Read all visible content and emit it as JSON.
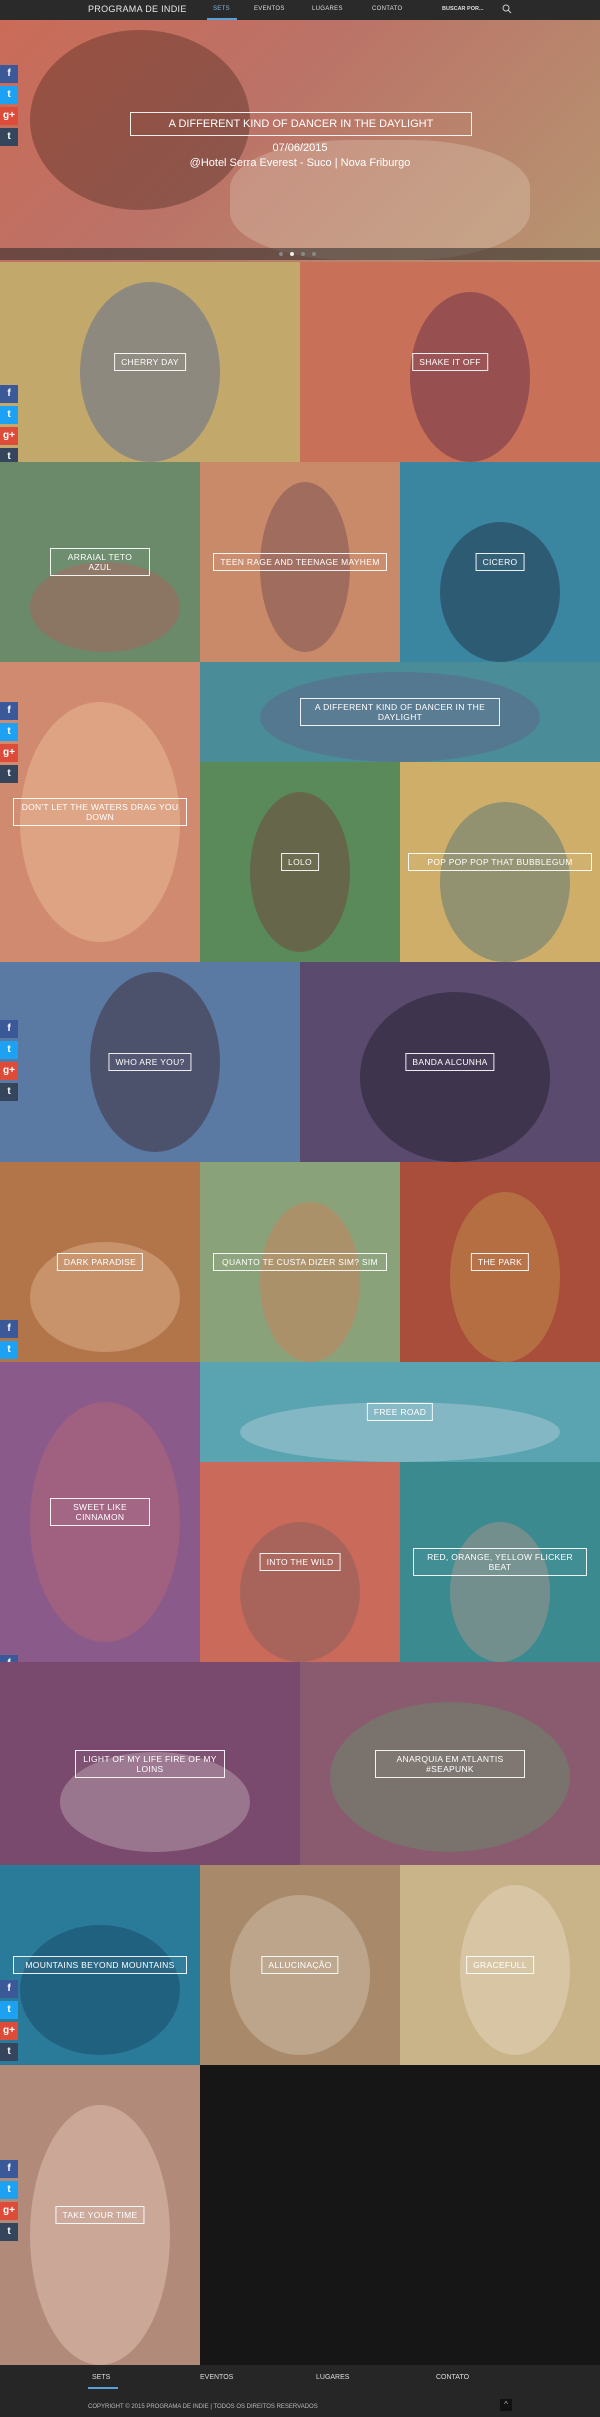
{
  "nav": {
    "logo": "PROGRAMA DE INDIE",
    "items": [
      "SETS",
      "EVENTOS",
      "LUGARES",
      "CONTATO"
    ],
    "active": "SETS",
    "search_placeholder": "BUSCAR POR..."
  },
  "hero": {
    "title": "A DIFFERENT KIND OF DANCER IN THE DAYLIGHT",
    "date": "07/06/2015",
    "venue": "@Hotel Serra Everest - Suco | Nova Friburgo",
    "slides": 4,
    "active_slide": 2
  },
  "share": {
    "facebook": "f",
    "twitter": "t",
    "googleplus": "g+",
    "tumblr": "t"
  },
  "sets": [
    {
      "title": "CHERRY DAY",
      "color": "#c2a86a"
    },
    {
      "title": "SHAKE IT OFF",
      "color": "#c97058"
    },
    {
      "title": "ARRAIAL TETO AZUL",
      "color": "#6a8a6a"
    },
    {
      "title": "TEEN RAGE AND TEENAGE MAYHEM",
      "color": "#c98a6a"
    },
    {
      "title": "CICERO",
      "color": "#3a86a0"
    },
    {
      "title": "DON'T LET THE WATERS DRAG YOU DOWN",
      "color": "#d08a70"
    },
    {
      "title": "A DIFFERENT KIND OF DANCER IN THE DAYLIGHT",
      "color": "#4a8c98"
    },
    {
      "title": "LOLO",
      "color": "#5a8a5a"
    },
    {
      "title": "POP POP POP THAT BUBBLEGUM",
      "color": "#cfae6a"
    },
    {
      "title": "WHO ARE YOU?",
      "color": "#5a7aa4"
    },
    {
      "title": "BANDA ALCUNHA",
      "color": "#5a4a6e"
    },
    {
      "title": "DARK PARADISE",
      "color": "#b2754a"
    },
    {
      "title": "QUANTO TE CUSTA DIZER SIM? SIM",
      "color": "#8aa27a"
    },
    {
      "title": "THE PARK",
      "color": "#a84e3a"
    },
    {
      "title": "FREE ROAD",
      "color": "#5aa4b2"
    },
    {
      "title": "SWEET LIKE CINNAMON",
      "color": "#8a5a8a"
    },
    {
      "title": "INTO THE WILD",
      "color": "#c96a5a"
    },
    {
      "title": "RED, ORANGE, YELLOW FLICKER BEAT",
      "color": "#3a8a90"
    },
    {
      "title": "LIGHT OF MY LIFE FIRE OF MY LOINS",
      "color": "#7a4a6e"
    },
    {
      "title": "ANARQUIA EM ATLANTIS #SEAPUNK",
      "color": "#8a5a6e"
    },
    {
      "title": "MOUNTAINS BEYOND MOUNTAINS",
      "color": "#2a7a9a"
    },
    {
      "title": "ALLUCINAÇÃO",
      "color": "#a88a6a"
    },
    {
      "title": "GRACEFULL",
      "color": "#c9b48a"
    },
    {
      "title": "TAKE YOUR TIME",
      "color": "#b28a7a"
    }
  ],
  "footer": {
    "links": [
      "SETS",
      "EVENTOS",
      "LUGARES",
      "CONTATO"
    ],
    "copyright": "COPYRIGHT © 2015 PROGRAMA DE INDIE | TODOS OS DIREITOS RESERVADOS",
    "to_top": "^"
  }
}
